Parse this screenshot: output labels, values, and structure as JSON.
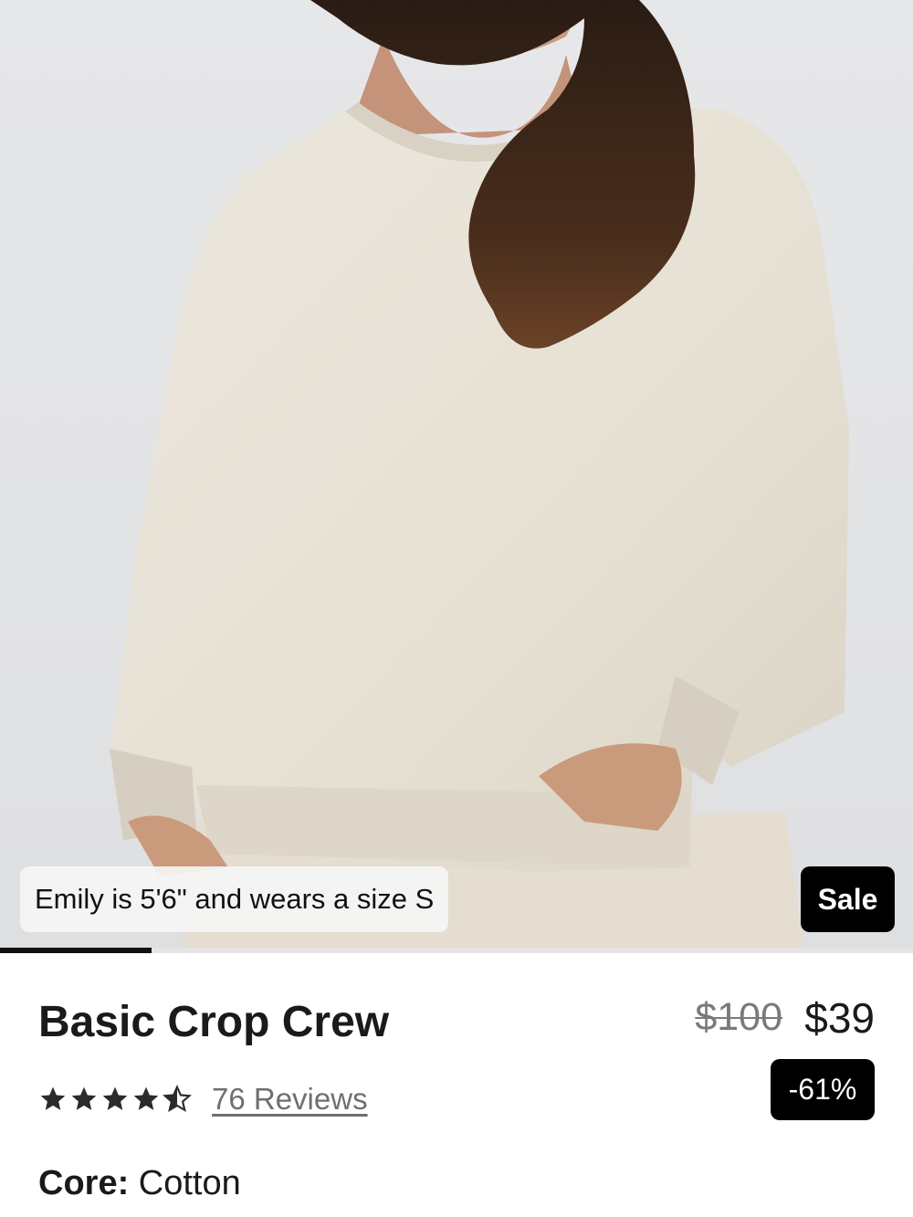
{
  "product_image": {
    "caption": "Emily is 5'6\" and wears a size S",
    "sale_badge": "Sale",
    "gallery_progress": 0.166
  },
  "product": {
    "title": "Basic Crop Crew",
    "original_price": "$100",
    "sale_price": "$39",
    "discount_badge": "-61%",
    "rating_stars": 4.5,
    "reviews_label": "76 Reviews",
    "material_key": "Core:",
    "material_value": "Cotton"
  },
  "colors": {
    "badge_bg": "#000000",
    "badge_text": "#ffffff",
    "text_primary": "#1a1a1a",
    "text_muted": "#6f6f6f",
    "sweater": "#e8e2d6"
  },
  "icons": [
    "star-icon",
    "half-star-icon"
  ]
}
